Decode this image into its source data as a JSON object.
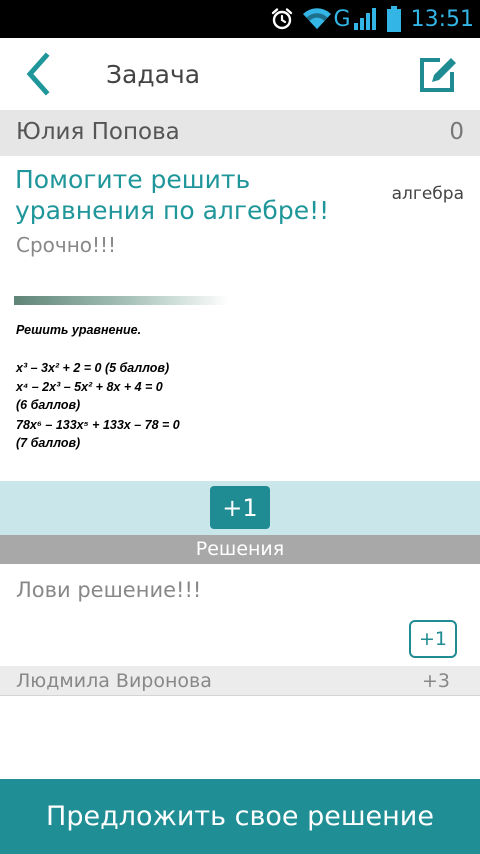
{
  "status_bar": {
    "network": "G",
    "time": "13:51",
    "icons": [
      "alarm-icon",
      "wifi-icon",
      "signal-icon",
      "battery-icon"
    ]
  },
  "app_bar": {
    "title": "Задача",
    "back_icon": "chevron-left-icon",
    "edit_icon": "edit-icon"
  },
  "author": {
    "name": "Юлия Попова",
    "score": "0"
  },
  "task": {
    "title": "Помогите решить уравнения по алгебре!!",
    "tag": "алгебра",
    "subtitle": "Срочно!!!",
    "image_lines": [
      "Решить уравнение.",
      "x³ – 3x² + 2 = 0 (5 баллов)",
      "x⁴ – 2x³ – 5x² + 8x + 4 = 0",
      "(6 баллов)",
      "78x⁶ – 133x⁵ + 133x – 78 = 0",
      "(7 баллов)"
    ]
  },
  "plus_button": "+1",
  "solutions_section": {
    "label": "Решения"
  },
  "solution": {
    "text": "Лови решение!!!",
    "plus_button": "+1",
    "author": "Людмила Виронова",
    "score": "+3"
  },
  "cta_label": "Предложить свое решение",
  "colors": {
    "accent": "#1f8b92",
    "title_teal": "#1f969a",
    "band": "#c9e6ea",
    "status_blue": "#33b5e5"
  }
}
